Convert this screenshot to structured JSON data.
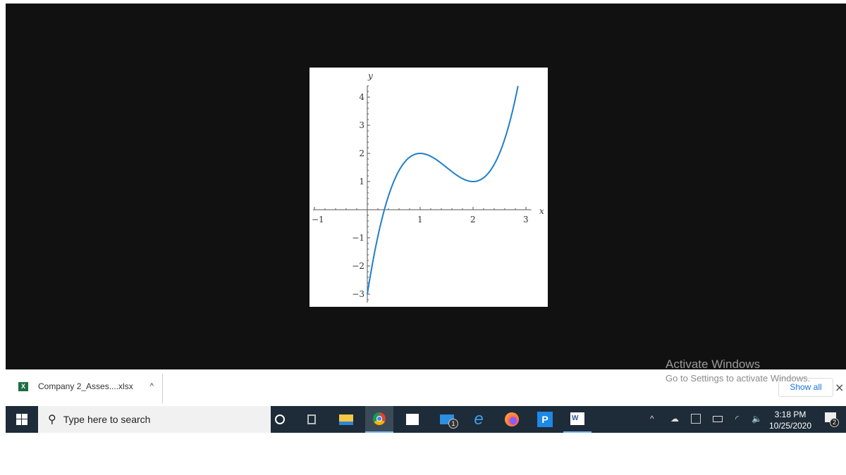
{
  "chart_data": {
    "type": "line",
    "xlabel": "x",
    "ylabel": "y",
    "xlim": [
      -1,
      3.1
    ],
    "ylim": [
      -3.3,
      4.4
    ],
    "x_ticks": [
      "-1",
      "1",
      "2",
      "3"
    ],
    "y_ticks": [
      "-3",
      "-2",
      "-1",
      "1",
      "2",
      "3",
      "4"
    ],
    "minor_tick_step": 0.2,
    "grid": false,
    "series": [
      {
        "color": "#1f7fc8",
        "x_range": [
          0,
          2.85
        ],
        "points": [
          [
            0,
            -3
          ],
          [
            0.25,
            -0.53
          ],
          [
            0.5,
            1
          ],
          [
            0.75,
            1.78
          ],
          [
            1,
            2
          ],
          [
            1.25,
            1.84
          ],
          [
            1.5,
            1.5
          ],
          [
            1.75,
            1.16
          ],
          [
            2,
            1
          ],
          [
            2.25,
            1.22
          ],
          [
            2.5,
            2
          ],
          [
            2.75,
            3.53
          ],
          [
            2.85,
            4.4
          ]
        ]
      }
    ]
  },
  "activation": {
    "title": "Activate Windows",
    "subtitle": "Go to Settings to activate Windows."
  },
  "download_bar": {
    "file_name": "Company 2_Asses....xlsx",
    "file_icon": "X",
    "show_all": "Show all",
    "close": "×",
    "chevron": "^"
  },
  "taskbar": {
    "search_placeholder": "Type here to search",
    "apps": [
      "cortana",
      "task-view",
      "file-explorer",
      "chrome",
      "store",
      "mail",
      "internet-explorer",
      "firefox",
      "pdf-app",
      "word"
    ],
    "mail_badge": "1",
    "word_label": "W",
    "time": "3:18 PM",
    "date": "10/25/2020",
    "notification_count": "2"
  }
}
